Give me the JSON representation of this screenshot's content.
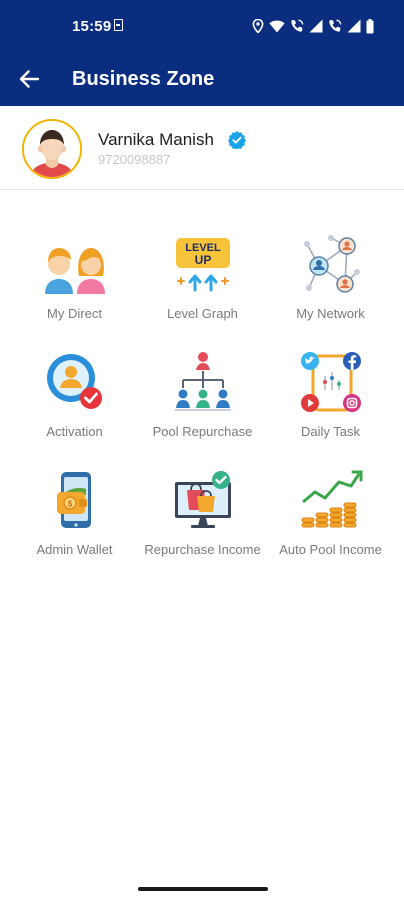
{
  "status_bar": {
    "time": "15:59",
    "icons": [
      "sim-card-icon",
      "location-icon",
      "wifi-icon",
      "call-signal-icon",
      "signal-icon",
      "call-signal-icon",
      "signal-icon",
      "battery-icon"
    ]
  },
  "header": {
    "back_icon": "arrow-left-icon",
    "title": "Business Zone",
    "background": "#0a2d80"
  },
  "profile": {
    "name": "Varnika Manish",
    "phone": "9720098887",
    "verified": true,
    "avatar_border": "#f2b400",
    "verified_color": "#1aa3e8"
  },
  "menu": [
    {
      "label": "My Direct",
      "icon": "users-couple-icon"
    },
    {
      "label": "Level Graph",
      "icon": "level-up-icon"
    },
    {
      "label": "My Network",
      "icon": "network-icon"
    },
    {
      "label": "Activation",
      "icon": "user-activation-icon"
    },
    {
      "label": "Pool Repurchase",
      "icon": "org-chart-icon"
    },
    {
      "label": "Daily Task",
      "icon": "social-media-icon"
    },
    {
      "label": "Admin Wallet",
      "icon": "wallet-phone-icon"
    },
    {
      "label": "Repurchase Income",
      "icon": "shopping-monitor-icon"
    },
    {
      "label": "Auto Pool Income",
      "icon": "coins-growth-icon"
    }
  ]
}
